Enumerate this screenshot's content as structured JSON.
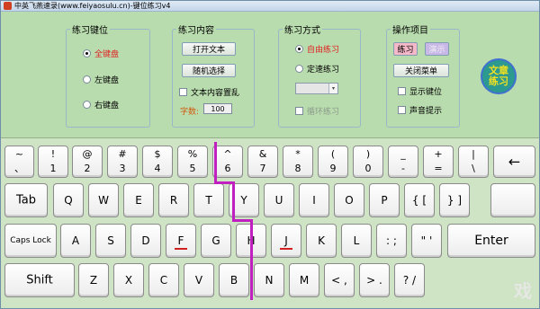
{
  "window": {
    "title": "中英飞燕速录(www.feiyaosulu.cn)-键位练习v4"
  },
  "groups": {
    "key_position": {
      "title": "练习键位",
      "options": [
        {
          "label": "全键盘",
          "selected": true
        },
        {
          "label": "左键盘",
          "selected": false
        },
        {
          "label": "右键盘",
          "selected": false
        }
      ]
    },
    "content": {
      "title": "练习内容",
      "open_text_button": "打开文本",
      "random_select_button": "随机选择",
      "shuffle_checkbox": "文本内容置乱",
      "font_size_label": "字数:",
      "font_size_value": "100"
    },
    "method": {
      "title": "练习方式",
      "options": [
        {
          "label": "自由练习",
          "selected": true
        },
        {
          "label": "定速练习",
          "selected": false
        }
      ],
      "loop_checkbox": "循环练习"
    },
    "operations": {
      "title": "操作项目",
      "practice_button": "练习",
      "demo_button": "演示",
      "close_menu_button": "关闭菜单",
      "show_key_checkbox": "显示键位",
      "sound_checkbox": "声音提示"
    },
    "article_button": {
      "line1": "文章",
      "line2": "练习"
    }
  },
  "keyboard": {
    "row1": [
      {
        "top": "~",
        "bot": "、"
      },
      {
        "top": "!",
        "bot": "1"
      },
      {
        "top": "@",
        "bot": "2"
      },
      {
        "top": "#",
        "bot": "3"
      },
      {
        "top": "$",
        "bot": "4"
      },
      {
        "top": "%",
        "bot": "5"
      },
      {
        "top": "^",
        "bot": "6"
      },
      {
        "top": "&",
        "bot": "7"
      },
      {
        "top": "*",
        "bot": "8"
      },
      {
        "top": "(",
        "bot": "9"
      },
      {
        "top": ")",
        "bot": "0"
      },
      {
        "top": "_",
        "bot": "-"
      },
      {
        "top": "+",
        "bot": "="
      },
      {
        "top": "|",
        "bot": "\\"
      },
      {
        "single": "←"
      }
    ],
    "row2": [
      "Tab",
      "Q",
      "W",
      "E",
      "R",
      "T",
      "Y",
      "U",
      "I",
      "O",
      "P",
      "{ [",
      "} ]"
    ],
    "row3": [
      "Caps Lock",
      "A",
      "S",
      "D",
      "F",
      "G",
      "H",
      "J",
      "K",
      "L",
      ": ;",
      "\" '",
      "Enter"
    ],
    "row4": [
      "Shift",
      "Z",
      "X",
      "C",
      "V",
      "B",
      "N",
      "M",
      "< ,",
      "> .",
      "? /"
    ]
  },
  "watermark": "戏"
}
